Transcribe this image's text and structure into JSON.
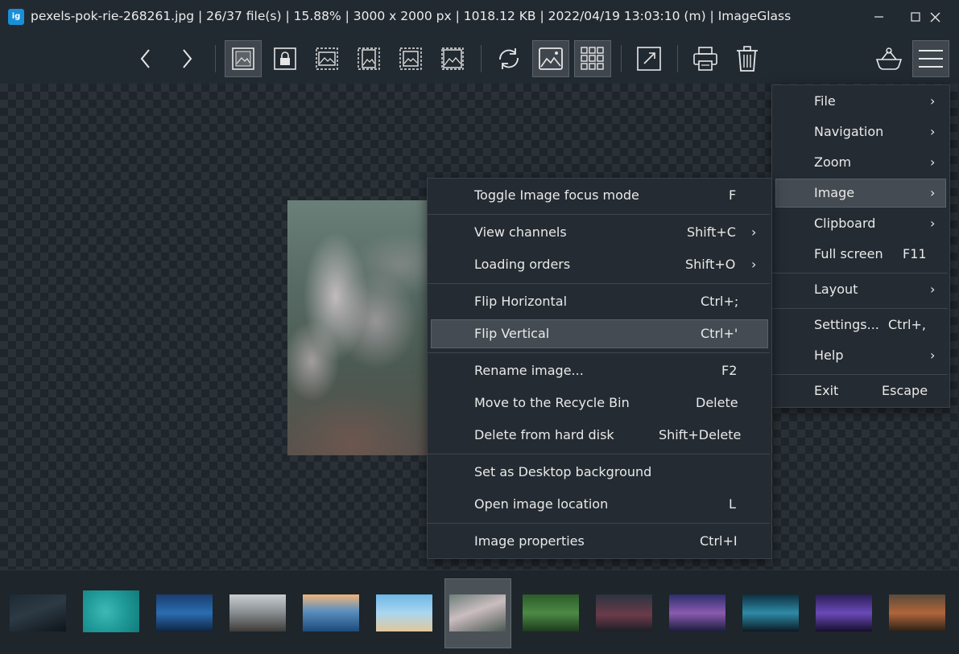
{
  "titlebar": {
    "app_icon_text": "ig",
    "title": "pexels-pok-rie-268261.jpg  |  26/37 file(s)  |  15.88%  |  3000 x 2000 px  |  1018.12 KB  |  2022/04/19 13:03:10 (m)  |  ImageGlass"
  },
  "toolbar": {
    "icons": [
      "previous-icon",
      "next-icon",
      "auto-zoom-icon",
      "lock-zoom-icon",
      "scale-to-width-icon",
      "scale-to-height-icon",
      "scale-to-fit-icon",
      "scale-to-fill-icon",
      "rotate-icon",
      "checkerboard-icon",
      "gallery-icon",
      "fullscreen-icon",
      "print-icon",
      "delete-icon",
      "plugin-icon",
      "menu-icon"
    ]
  },
  "main_menu": {
    "items": [
      {
        "label": "File",
        "shortcut": "",
        "submenu": true
      },
      {
        "label": "Navigation",
        "shortcut": "",
        "submenu": true
      },
      {
        "label": "Zoom",
        "shortcut": "",
        "submenu": true
      },
      {
        "label": "Image",
        "shortcut": "",
        "submenu": true,
        "selected": true
      },
      {
        "label": "Clipboard",
        "shortcut": "",
        "submenu": true
      },
      {
        "label": "Full screen",
        "shortcut": "F11",
        "submenu": false
      },
      {
        "label": "Layout",
        "shortcut": "",
        "submenu": true
      },
      {
        "label": "Settings...",
        "shortcut": "Ctrl+,",
        "submenu": false
      },
      {
        "label": "Help",
        "shortcut": "",
        "submenu": true
      },
      {
        "label": "Exit",
        "shortcut": "Escape",
        "submenu": false
      }
    ]
  },
  "image_menu": {
    "items": [
      {
        "label": "Toggle Image focus mode",
        "shortcut": "F",
        "submenu": false
      },
      {
        "label": "View channels",
        "shortcut": "Shift+C",
        "submenu": true
      },
      {
        "label": "Loading orders",
        "shortcut": "Shift+O",
        "submenu": true
      },
      {
        "label": "Flip Horizontal",
        "shortcut": "Ctrl+;",
        "submenu": false
      },
      {
        "label": "Flip Vertical",
        "shortcut": "Ctrl+'",
        "submenu": false,
        "selected": true
      },
      {
        "label": "Rename image...",
        "shortcut": "F2",
        "submenu": false
      },
      {
        "label": "Move to the Recycle Bin",
        "shortcut": "Delete",
        "submenu": false
      },
      {
        "label": "Delete from hard disk",
        "shortcut": "Shift+Delete",
        "submenu": false
      },
      {
        "label": "Set as Desktop background",
        "shortcut": "",
        "submenu": false
      },
      {
        "label": "Open image location",
        "shortcut": "L",
        "submenu": false
      },
      {
        "label": "Image properties",
        "shortcut": "Ctrl+I",
        "submenu": false
      }
    ]
  },
  "thumbnails": {
    "count": 13,
    "selected_index": 6
  },
  "colors": {
    "background": "#232a31",
    "menu_background": "#242b32",
    "menu_selected": "#444b52",
    "toolbar_active": "#3f464d",
    "app_icon": "#1a8fd8"
  }
}
